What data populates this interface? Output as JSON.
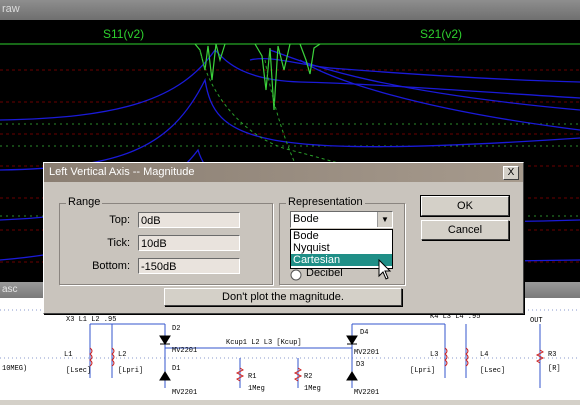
{
  "window": {
    "title": "raw"
  },
  "plot": {
    "trace_left_label": "S11(v2)",
    "trace_right_label": "S21(v2)",
    "label_color": "#2ed02e"
  },
  "schematic_strip": {
    "title": "asc"
  },
  "schematic": {
    "labels": [
      "X3 L1 L2 .95",
      "L1",
      "L2",
      "[Lsec]",
      "[Lpri]",
      "10MEG)",
      "D2",
      "MV2201",
      "D1",
      "MV2201",
      "R1",
      "1Meg",
      "Kcup1 L2 L3 [Kcup]",
      "R2",
      "1Meg",
      "D4",
      "MV2201",
      "D3",
      "MV2201",
      "K4 L3 L4 .95",
      "L3",
      "L4",
      "[Lpri]",
      "[Lsec]",
      "OUT",
      "R3",
      "[R]"
    ]
  },
  "dialog": {
    "title": "Left Vertical Axis -- Magnitude",
    "close_label": "X",
    "range": {
      "label": "Range",
      "top_label": "Top:",
      "top_value": "0dB",
      "tick_label": "Tick:",
      "tick_value": "10dB",
      "bottom_label": "Bottom:",
      "bottom_value": "-150dB"
    },
    "representation": {
      "label": "Representation",
      "selected": "Bode",
      "options": [
        "Bode",
        "Nyquist",
        "Cartesian"
      ],
      "highlighted": "Cartesian",
      "radio_label": "Decibel"
    },
    "ok_label": "OK",
    "cancel_label": "Cancel",
    "dont_plot_label": "Don't plot the magnitude."
  },
  "colors": {
    "trace_blue": "#1a1ad8",
    "trace_green": "#3bd23b",
    "grid_red": "#7a0000",
    "highlight": "#1f8f87"
  }
}
